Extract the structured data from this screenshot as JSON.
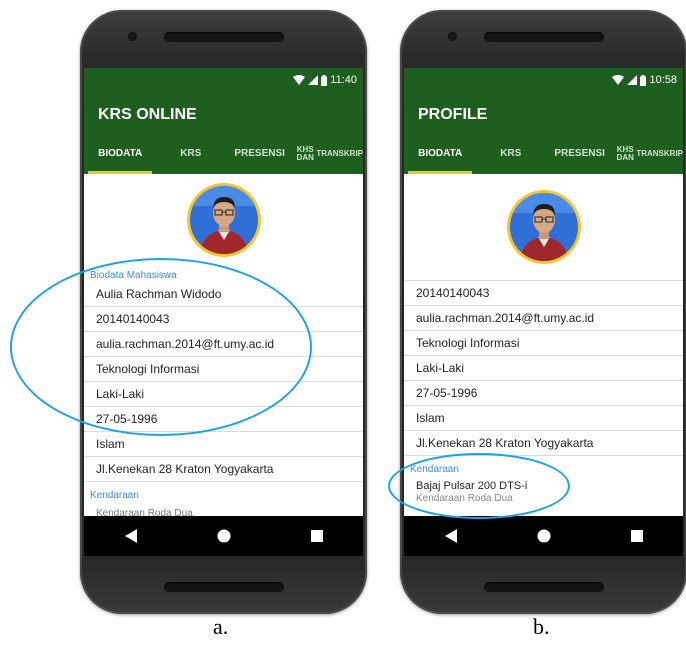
{
  "phone_a": {
    "status_time": "11:40",
    "app_title": "KRS ONLINE",
    "tabs": [
      "BIODATA",
      "KRS",
      "PRESENSI",
      "KHS DAN",
      "TRANSKRIP"
    ],
    "section_biodata": "Biodata Mahasiswa",
    "fields": [
      "Aulia Rachman Widodo",
      "20140140043",
      "aulia.rachman.2014@ft.umy.ac.id",
      "Teknologi Informasi",
      "Laki-Laki",
      "27-05-1996",
      "Islam",
      "Jl.Kenekan  28 Kraton Yogyakarta"
    ],
    "section_vehicle": "Kendaraan",
    "peek_text": "Kendaraan Roda Dua"
  },
  "phone_b": {
    "status_time": "10:58",
    "app_title": "PROFILE",
    "tabs": [
      "BIODATA",
      "KRS",
      "PRESENSI",
      "KHS DAN",
      "TRANSKRIP"
    ],
    "fields": [
      "20140140043",
      "aulia.rachman.2014@ft.umy.ac.id",
      "Teknologi Informasi",
      "Laki-Laki",
      "27-05-1996",
      "Islam",
      "Jl.Kenekan  28 Kraton Yogyakarta"
    ],
    "section_vehicle": "Kendaraan",
    "vehicle_name": "Bajaj Pulsar 200 DTS-i",
    "vehicle_type": "Kendaraan Roda Dua"
  },
  "captions": {
    "a": "a.",
    "b": "b."
  },
  "colors": {
    "app_bar": "#1e5e1e",
    "tab_indicator": "#f4c430",
    "section_label": "#3b8fd4",
    "highlight_ellipse": "#1fa3e0"
  },
  "icons": [
    "wifi-icon",
    "signal-icon",
    "battery-icon",
    "back-icon",
    "home-icon",
    "recents-icon"
  ]
}
